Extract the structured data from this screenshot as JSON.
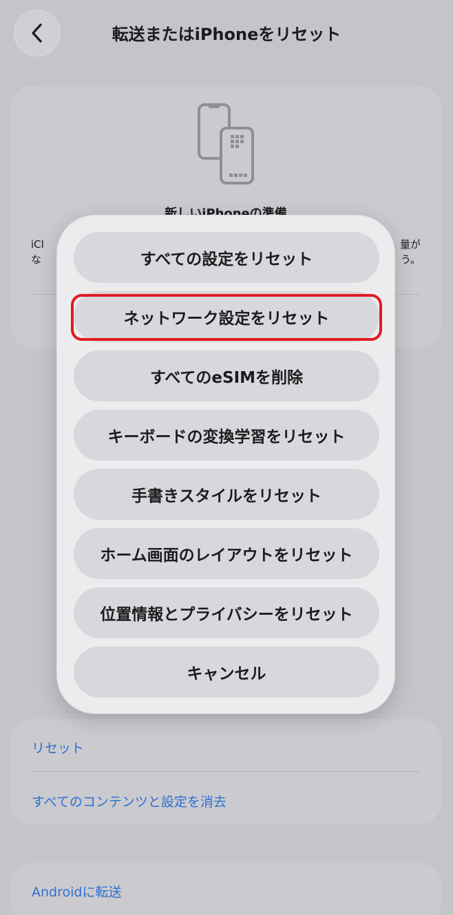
{
  "header": {
    "title": "転送またはiPhoneをリセット",
    "back_icon": "chevron-left-icon"
  },
  "prepare_card": {
    "icon": "phones-transfer-icon",
    "heading": "新しいiPhoneの準備",
    "body_left_fragment": "iCl\nな",
    "body_right_fragment": "量が\nう。"
  },
  "reset_card": {
    "reset_link": "リセット",
    "erase_link": "すべてのコンテンツと設定を消去"
  },
  "android_card": {
    "transfer_link": "Androidに転送"
  },
  "action_sheet": {
    "options": [
      "すべての設定をリセット",
      "ネットワーク設定をリセット",
      "すべてのeSIMを削除",
      "キーボードの変換学習をリセット",
      "手書きスタイルをリセット",
      "ホーム画面のレイアウトをリセット",
      "位置情報とプライバシーをリセット",
      "キャンセル"
    ],
    "highlighted_index": 1,
    "highlight_color": "#e11b22"
  },
  "colors": {
    "link": "#2f6fcf",
    "background": "#c4c4c9"
  }
}
